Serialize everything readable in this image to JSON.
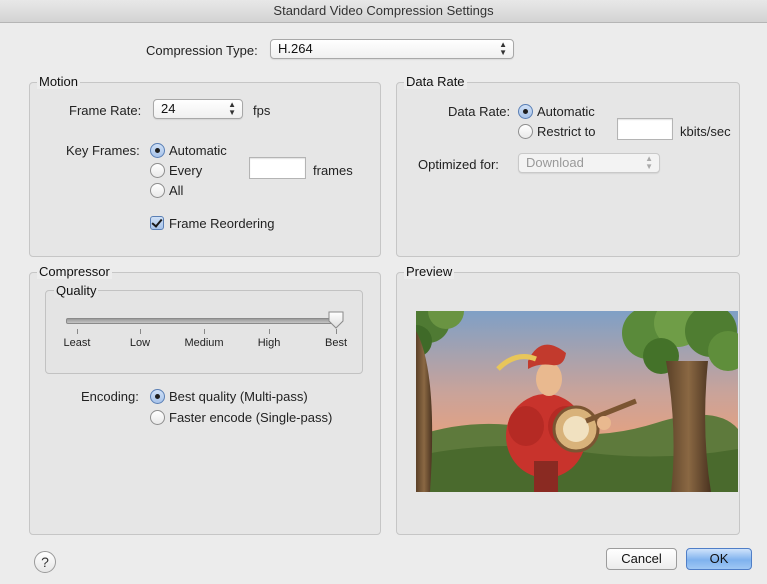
{
  "window": {
    "title": "Standard Video Compression Settings"
  },
  "compression": {
    "label": "Compression Type:",
    "value": "H.264"
  },
  "motion": {
    "title": "Motion",
    "frame_rate_label": "Frame Rate:",
    "frame_rate_value": "24",
    "frame_rate_unit": "fps",
    "key_frames_label": "Key Frames:",
    "key_frames_options": [
      "Automatic",
      "Every",
      "All"
    ],
    "key_frames_selected": "Automatic",
    "every_value": "",
    "every_unit": "frames",
    "frame_reordering_label": "Frame Reordering",
    "frame_reordering_checked": true
  },
  "data_rate": {
    "title": "Data Rate",
    "label": "Data Rate:",
    "options": [
      "Automatic",
      "Restrict to"
    ],
    "selected": "Automatic",
    "restrict_value": "",
    "restrict_unit": "kbits/sec",
    "optimized_label": "Optimized for:",
    "optimized_value": "Download"
  },
  "compressor": {
    "title": "Compressor",
    "quality_title": "Quality",
    "quality_ticks": [
      "Least",
      "Low",
      "Medium",
      "High",
      "Best"
    ],
    "quality_selected": "Best",
    "encoding_label": "Encoding:",
    "encoding_options": [
      "Best quality (Multi-pass)",
      "Faster encode (Single-pass)"
    ],
    "encoding_selected": "Best quality (Multi-pass)"
  },
  "preview": {
    "title": "Preview"
  },
  "buttons": {
    "help": "?",
    "cancel": "Cancel",
    "ok": "OK"
  }
}
